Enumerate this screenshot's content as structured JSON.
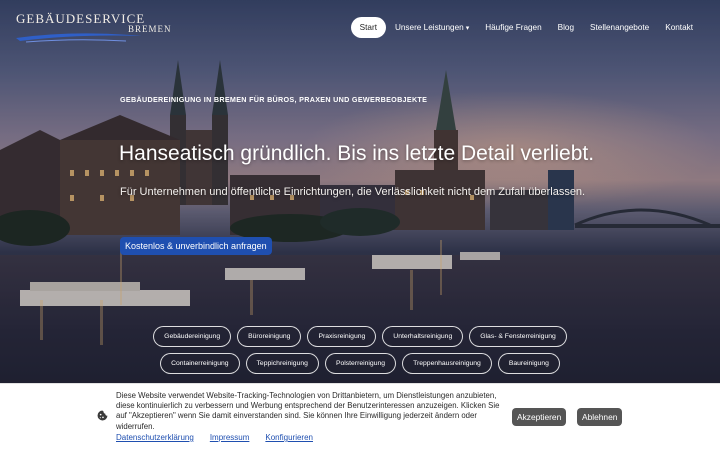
{
  "brand": {
    "name": "GEBÄUDESERVICE",
    "city": "BREMEN"
  },
  "nav": {
    "items": [
      {
        "label": "Start",
        "active": true
      },
      {
        "label": "Unsere Leistungen",
        "caret": "▾"
      },
      {
        "label": "Häufige Fragen"
      },
      {
        "label": "Blog"
      },
      {
        "label": "Stellenangebote"
      },
      {
        "label": "Kontakt"
      }
    ]
  },
  "hero": {
    "eyebrow": "GEBÄUDEREINIGUNG IN BREMEN FÜR BÜROS, PRAXEN UND GEWERBEOBJEKTE",
    "headline": "Hanseatisch gründlich. Bis ins letzte Detail verliebt.",
    "subline": "Für Unternehmen und öffentliche Einrichtungen, die Verlässlichkeit nicht dem Zufall überlassen.",
    "cta": "Kostenlos & unverbindlich anfragen"
  },
  "services": {
    "row1": [
      "Gebäudereinigung",
      "Büroreinigung",
      "Praxisreinigung",
      "Unterhaltsreinigung",
      "Glas- & Fensterreinigung"
    ],
    "row2": [
      "Containerreinigung",
      "Teppichreinigung",
      "Polsterreinigung",
      "Treppenhausreinigung",
      "Baureinigung"
    ]
  },
  "cookie": {
    "text": "Diese Website verwendet Website-Tracking-Technologien von Drittanbietern, um Dienstleistungen anzubieten, diese kontinuierlich zu verbessern und Werbung entsprechend der Benutzerinteressen anzuzeigen. Klicken Sie auf \"Akzeptieren\" wenn Sie damit einverstanden sind. Sie können Ihre Einwilligung jederzeit ändern oder widerrufen.",
    "links": {
      "privacy": "Datenschutzerklärung",
      "imprint": "Impressum",
      "configure": "Konfigurieren"
    },
    "accept": "Akzeptieren",
    "decline": "Ablehnen"
  },
  "colors": {
    "accent": "#1f4fb0",
    "cookie_button": "#555555",
    "nav_active_bg": "#ffffff"
  }
}
